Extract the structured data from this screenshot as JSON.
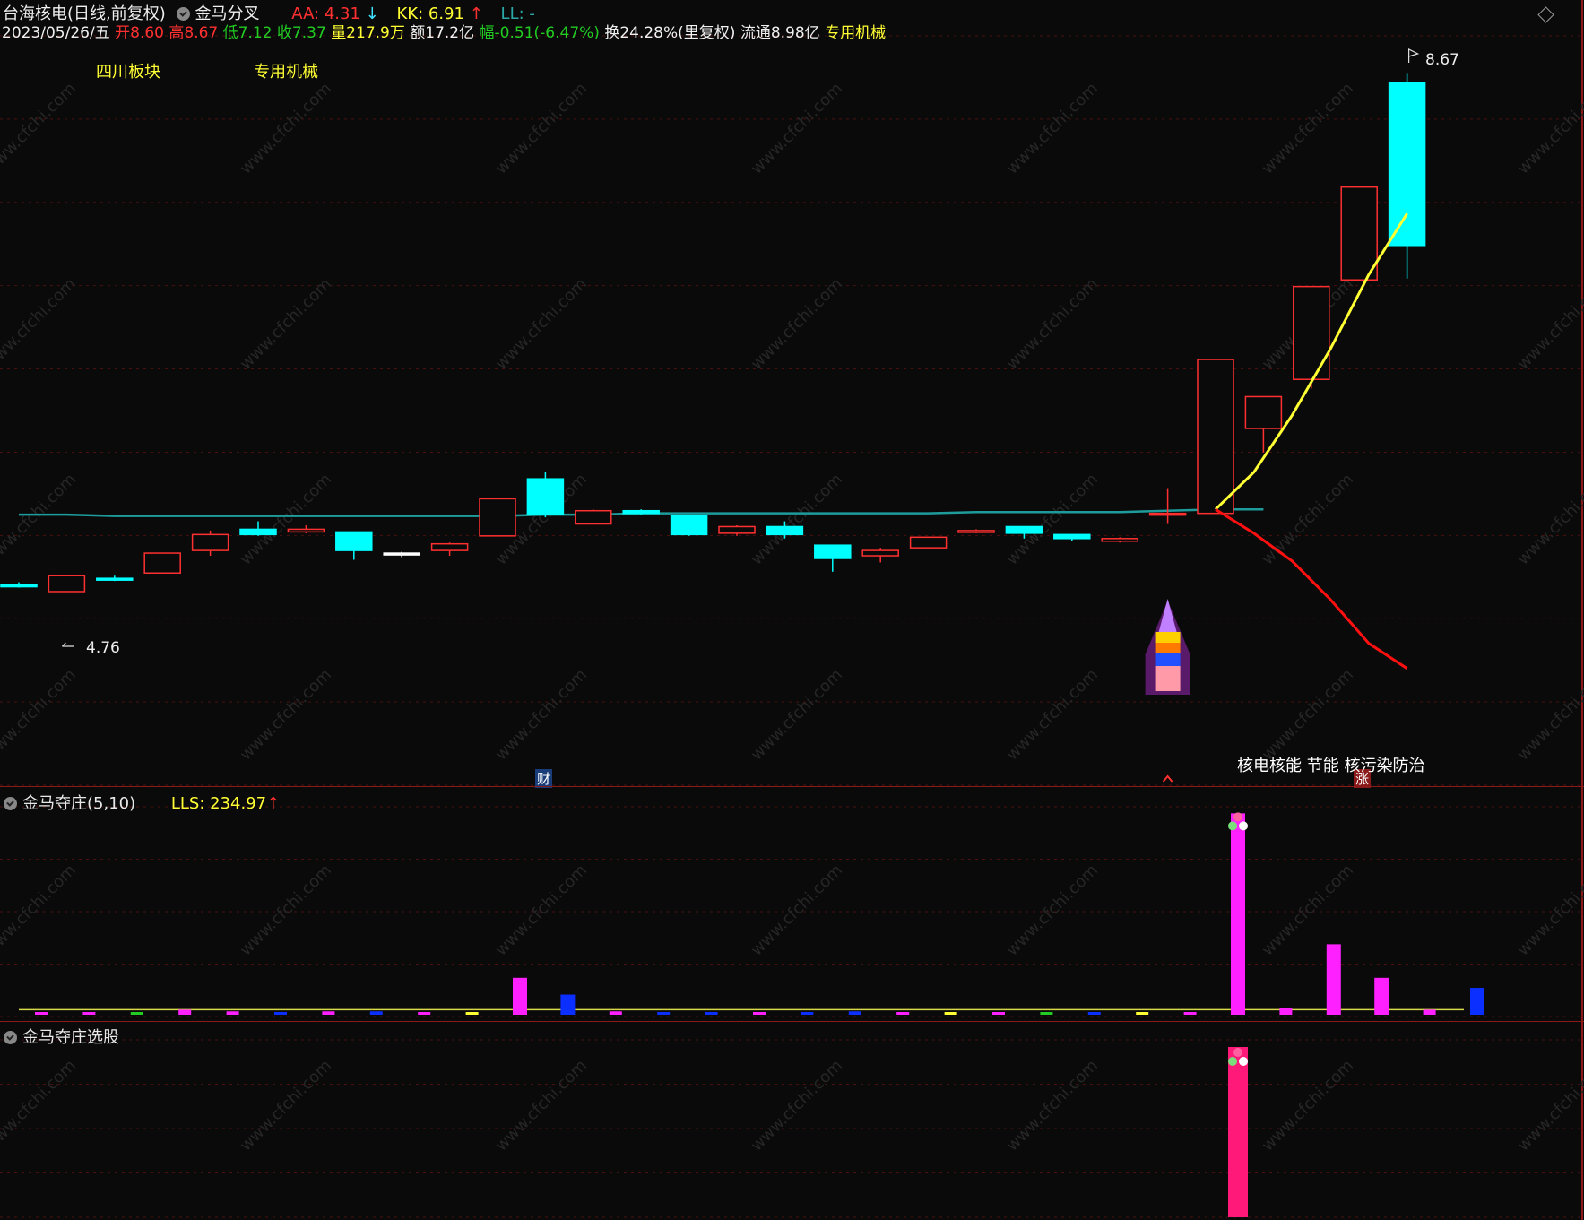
{
  "header": {
    "title": "台海核电(日线,前复权)",
    "indicator_name": "金马分叉",
    "aa": {
      "label": "AA: 4.31",
      "arrow": "↓",
      "color": "#ff3030",
      "arrow_color": "#40e0ff"
    },
    "kk": {
      "label": "KK: 6.91",
      "arrow": "↑",
      "color": "#ffff33",
      "arrow_color": "#ff3030"
    },
    "ll": {
      "label": "LL: -",
      "color": "#2aa8a8"
    },
    "date": "2023/05/26/五",
    "open": "开8.60",
    "high": "高8.67",
    "low": "低7.12",
    "close": "收7.37",
    "volume": "量217.9万",
    "amount": "额17.2亿",
    "change": "幅-0.51(-6.47%)",
    "turnover": "换24.28%(里复权)",
    "float_cap": "流通8.98亿",
    "industry": "专用机械"
  },
  "sectors": {
    "region": "四川板块",
    "industry": "专用机械"
  },
  "price_pane": {
    "high_label": "8.67",
    "low_label": "4.76",
    "fin_marker": "财",
    "rise_marker": "涨",
    "concepts": "核电核能 节能 核污染防治"
  },
  "pane2": {
    "title": "金马夺庄(5,10)",
    "lls_label": "LLS: 234.97",
    "lls_arrow": "↑"
  },
  "pane3": {
    "title": "金马夺庄选股"
  },
  "colors": {
    "bg": "#0a0a0a",
    "up": "#ff3030",
    "down": "#00ffff",
    "ma": "#1e9c9c",
    "fork_yellow": "#ffff33",
    "fork_red": "#ff1010",
    "magenta": "#ff20ff",
    "blue": "#0b2fff",
    "pink": "#ff1a7a",
    "divider": "#8a1a1a"
  },
  "watermark": "www.cfchi.com",
  "icons": [
    "dropdown-check-icon",
    "diamond-icon",
    "rocket-icon",
    "flag-icon"
  ],
  "chart_data": [
    {
      "type": "candlestick",
      "title": "",
      "candles": [
        {
          "o": 4.81,
          "h": 4.83,
          "l": 4.79,
          "c": 4.8
        },
        {
          "o": 4.76,
          "h": 4.88,
          "l": 4.76,
          "c": 4.88
        },
        {
          "o": 4.86,
          "h": 4.88,
          "l": 4.84,
          "c": 4.85
        },
        {
          "o": 4.9,
          "h": 5.05,
          "l": 4.9,
          "c": 5.05
        },
        {
          "o": 5.07,
          "h": 5.22,
          "l": 5.03,
          "c": 5.19
        },
        {
          "o": 5.23,
          "h": 5.29,
          "l": 5.18,
          "c": 5.19
        },
        {
          "o": 5.21,
          "h": 5.26,
          "l": 5.2,
          "c": 5.23
        },
        {
          "o": 5.21,
          "h": 5.21,
          "l": 5.0,
          "c": 5.07
        },
        {
          "o": 5.05,
          "h": 5.06,
          "l": 5.02,
          "c": 5.04
        },
        {
          "o": 5.07,
          "h": 5.13,
          "l": 5.03,
          "c": 5.12
        },
        {
          "o": 5.18,
          "h": 5.47,
          "l": 5.18,
          "c": 5.46
        },
        {
          "o": 5.61,
          "h": 5.66,
          "l": 5.32,
          "c": 5.34
        },
        {
          "o": 5.27,
          "h": 5.38,
          "l": 5.27,
          "c": 5.37
        },
        {
          "o": 5.37,
          "h": 5.38,
          "l": 5.34,
          "c": 5.35
        },
        {
          "o": 5.33,
          "h": 5.34,
          "l": 5.18,
          "c": 5.19
        },
        {
          "o": 5.2,
          "h": 5.26,
          "l": 5.18,
          "c": 5.25
        },
        {
          "o": 5.25,
          "h": 5.29,
          "l": 5.16,
          "c": 5.19
        },
        {
          "o": 5.11,
          "h": 5.11,
          "l": 4.91,
          "c": 5.01
        },
        {
          "o": 5.03,
          "h": 5.09,
          "l": 4.98,
          "c": 5.07
        },
        {
          "o": 5.09,
          "h": 5.17,
          "l": 5.09,
          "c": 5.17
        },
        {
          "o": 5.21,
          "h": 5.23,
          "l": 5.2,
          "c": 5.22
        },
        {
          "o": 5.25,
          "h": 5.25,
          "l": 5.16,
          "c": 5.2
        },
        {
          "o": 5.19,
          "h": 5.19,
          "l": 5.14,
          "c": 5.16
        },
        {
          "o": 5.14,
          "h": 5.17,
          "l": 5.13,
          "c": 5.16
        },
        {
          "o": 5.35,
          "h": 5.54,
          "l": 5.27,
          "c": 5.35
        },
        {
          "o": 5.35,
          "h": 6.51,
          "l": 5.35,
          "c": 6.51
        },
        {
          "o": 5.99,
          "h": 6.08,
          "l": 5.81,
          "c": 6.23
        },
        {
          "o": 6.36,
          "h": 7.06,
          "l": 6.29,
          "c": 7.06
        },
        {
          "o": 7.11,
          "h": 7.81,
          "l": 7.11,
          "c": 7.81
        },
        {
          "o": 8.6,
          "h": 8.67,
          "l": 7.12,
          "c": 7.37
        }
      ],
      "ma": [
        5.34,
        5.34,
        5.33,
        5.33,
        5.33,
        5.33,
        5.33,
        5.33,
        5.33,
        5.33,
        5.33,
        5.34,
        5.34,
        5.35,
        5.35,
        5.35,
        5.35,
        5.35,
        5.35,
        5.35,
        5.36,
        5.36,
        5.36,
        5.36,
        5.37,
        5.38,
        5.38
      ],
      "fork_upper": [
        5.38,
        5.66,
        6.09,
        6.59,
        7.15,
        7.61
      ],
      "fork_lower": [
        5.38,
        5.2,
        4.99,
        4.7,
        4.37,
        4.18
      ],
      "ylim": [
        3.3,
        8.95
      ]
    },
    {
      "type": "bar",
      "title": "金马夺庄(5,10)",
      "values": [
        1,
        1,
        1,
        3,
        2,
        1,
        2,
        2,
        1,
        1,
        22,
        12,
        2,
        1,
        1,
        1,
        1,
        2,
        1,
        1,
        1,
        1,
        1,
        1,
        1,
        120,
        4,
        42,
        22,
        3,
        16
      ],
      "colors": [
        "magenta",
        "magenta",
        "green",
        "magenta",
        "magenta",
        "blue",
        "magenta",
        "blue",
        "magenta",
        "yellow",
        "magenta",
        "blue",
        "magenta",
        "blue",
        "blue",
        "magenta",
        "blue",
        "blue",
        "magenta",
        "yellow",
        "magenta",
        "green",
        "blue",
        "yellow",
        "magenta",
        "magenta",
        "magenta",
        "magenta",
        "magenta",
        "magenta",
        "blue"
      ],
      "line_value": 3,
      "ylim": [
        0,
        125
      ]
    },
    {
      "type": "bar",
      "title": "金马夺庄选股",
      "values": [
        1
      ],
      "signal_day": 25,
      "ylim": [
        0,
        1
      ]
    }
  ]
}
